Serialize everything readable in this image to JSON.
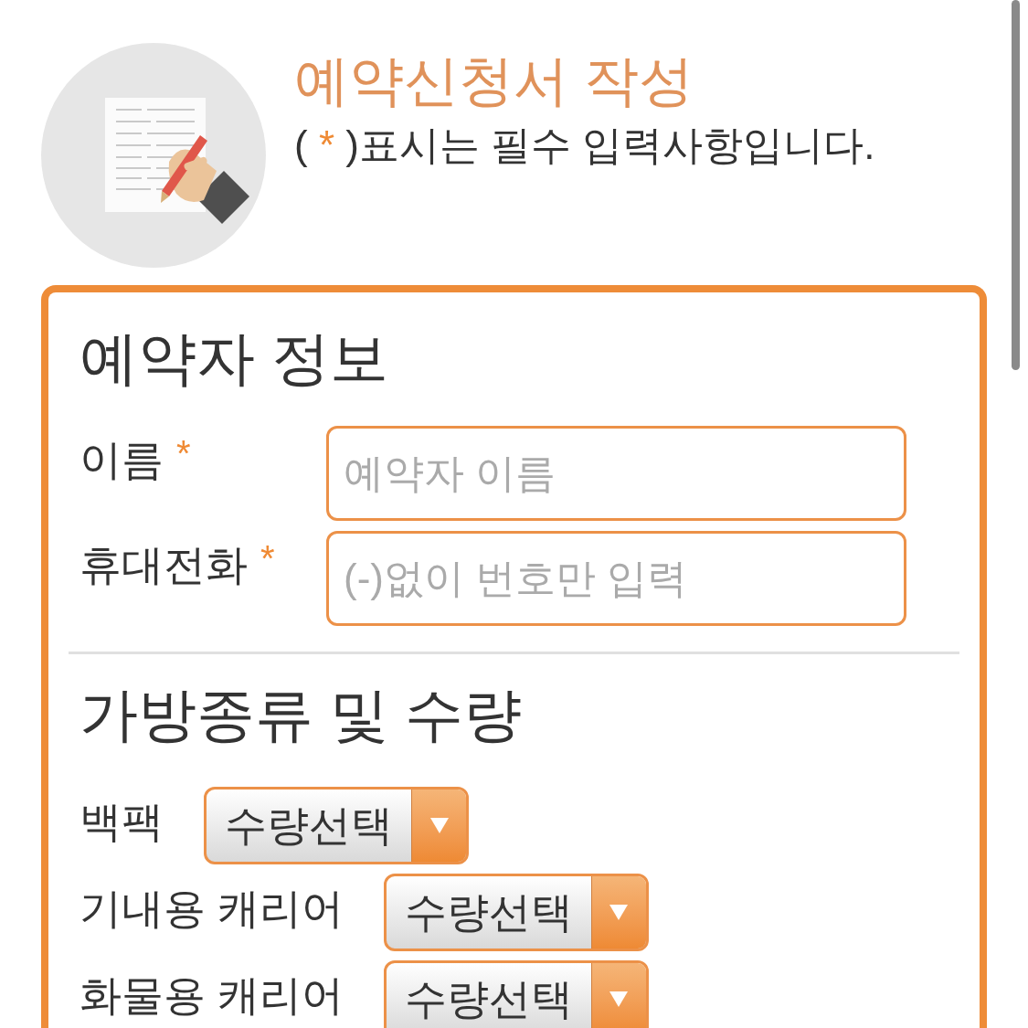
{
  "header": {
    "title": "예약신청서 작성",
    "note": {
      "before": "( ",
      "mark": "*",
      "after": " )표시는 필수 입력사항입니다."
    }
  },
  "sections": [
    {
      "kind": "fields",
      "title": "예약자 정보",
      "fields": [
        {
          "label": "이름",
          "mark": "*",
          "placeholder": "예약자 이름"
        },
        {
          "label": "휴대전화",
          "mark": "*",
          "placeholder": "(-)없이 번호만 입력"
        }
      ]
    },
    {
      "kind": "quantities",
      "title": "가방종류 및 수량",
      "rows": [
        {
          "label": "백팩",
          "value": "수량선택"
        },
        {
          "label": "기내용 캐리어",
          "value": "수량선택"
        },
        {
          "label": "화물용 캐리어",
          "value": "수량선택"
        }
      ]
    }
  ]
}
